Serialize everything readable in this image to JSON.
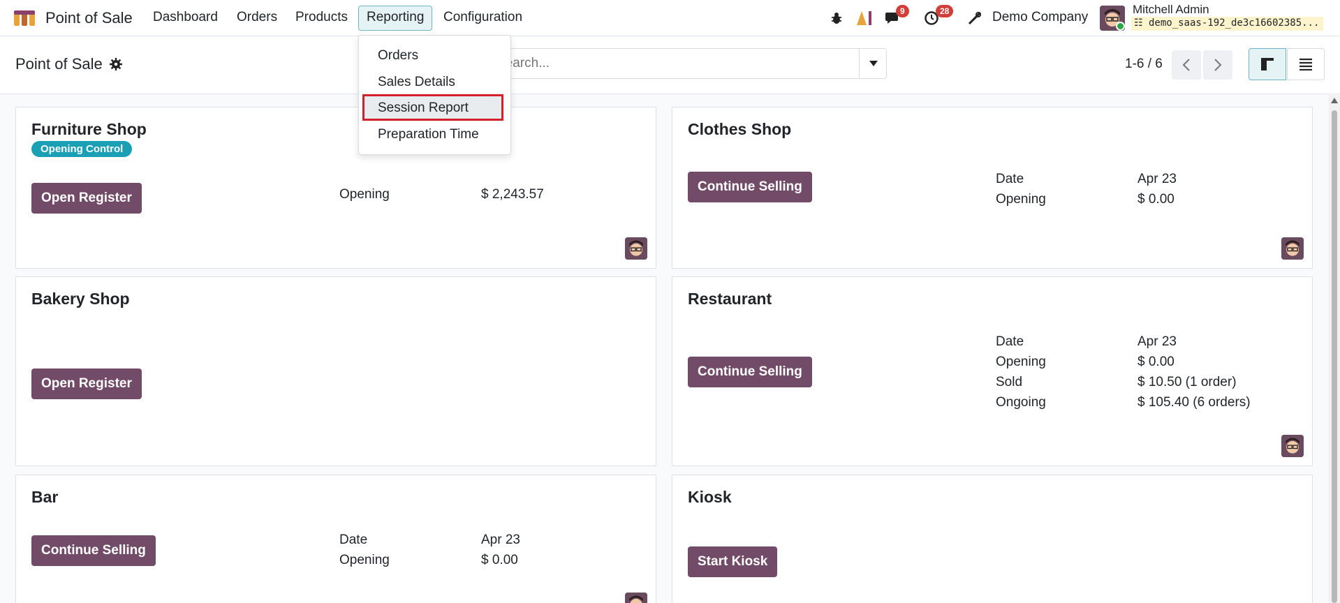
{
  "navbar": {
    "app_name": "Point of Sale",
    "menu": [
      "Dashboard",
      "Orders",
      "Products",
      "Reporting",
      "Configuration"
    ],
    "messages_count": "9",
    "activities_count": "28",
    "company": "Demo Company",
    "user_name": "Mitchell Admin",
    "database": "demo_saas-192_de3c16602385..."
  },
  "control_panel": {
    "breadcrumb": "Point of Sale",
    "search_placeholder": "Search...",
    "pager": "1-6 / 6"
  },
  "reporting_dropdown": {
    "items": [
      "Orders",
      "Sales Details",
      "Session Report",
      "Preparation Time"
    ],
    "highlighted": "Session Report"
  },
  "cards": [
    {
      "title": "Furniture Shop",
      "tag": "Opening Control",
      "button": "Open Register",
      "rows": [
        {
          "label": "Opening",
          "value": "$ 2,243.57"
        }
      ]
    },
    {
      "title": "Clothes Shop",
      "button": "Continue Selling",
      "rows": [
        {
          "label": "Date",
          "value": "Apr 23"
        },
        {
          "label": "Opening",
          "value": "$ 0.00"
        }
      ]
    },
    {
      "title": "Bakery Shop",
      "button": "Open Register",
      "rows": []
    },
    {
      "title": "Restaurant",
      "button": "Continue Selling",
      "rows": [
        {
          "label": "Date",
          "value": "Apr 23"
        },
        {
          "label": "Opening",
          "value": "$ 0.00"
        },
        {
          "label": "Sold",
          "value": "$ 10.50 (1 order)"
        },
        {
          "label": "Ongoing",
          "value": "$ 105.40 (6 orders)"
        }
      ]
    },
    {
      "title": "Bar",
      "button": "Continue Selling",
      "rows": [
        {
          "label": "Date",
          "value": "Apr 23"
        },
        {
          "label": "Opening",
          "value": "$ 0.00"
        }
      ]
    },
    {
      "title": "Kiosk",
      "button": "Start Kiosk",
      "rows": []
    }
  ],
  "colors": {
    "primary": "#714b67",
    "tag": "#1a9fb5",
    "badge": "#d23f3a",
    "highlight_border": "#d4202a"
  }
}
